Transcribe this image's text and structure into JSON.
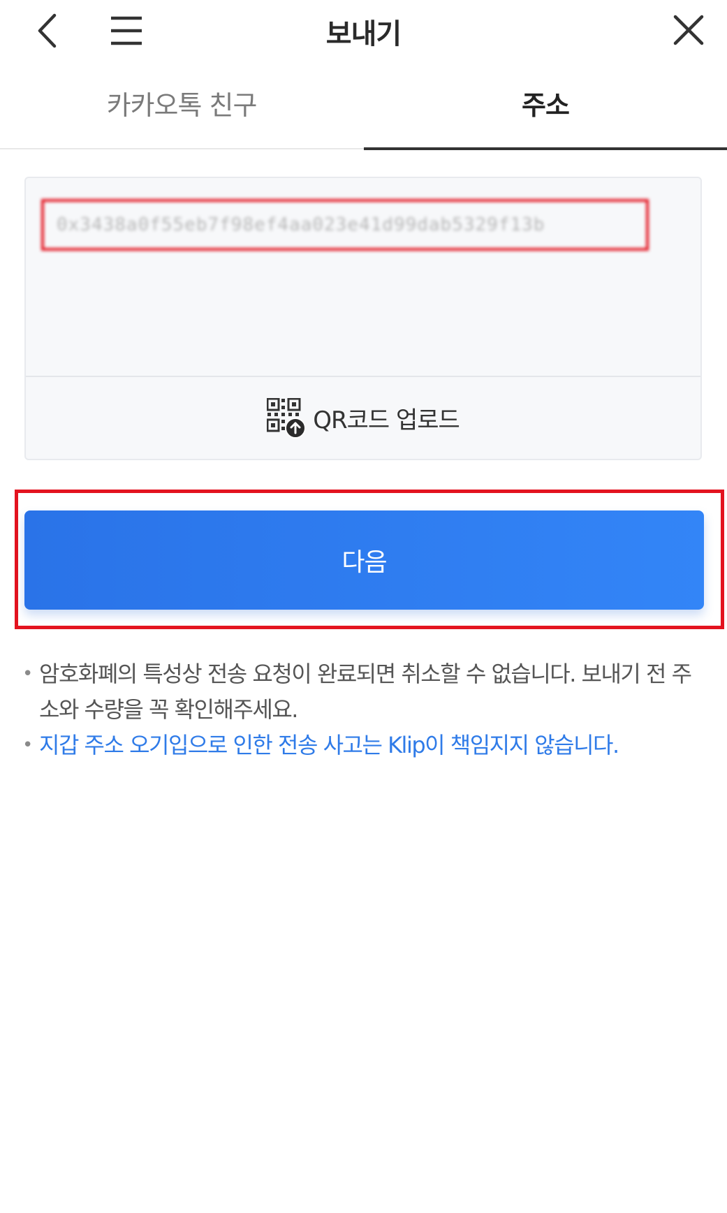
{
  "header": {
    "title": "보내기",
    "back_icon": "chevron-left-icon",
    "menu_icon": "hamburger-menu-icon",
    "close_icon": "close-icon"
  },
  "tabs": [
    {
      "label": "카카오톡 친구",
      "active": false
    },
    {
      "label": "주소",
      "active": true
    }
  ],
  "address": {
    "value": "0x3438a0f55eb7f98ef4aa023e41d99dab5329f13b",
    "qr_upload_label": "QR코드 업로드",
    "qr_icon": "qr-upload-icon"
  },
  "next_button_label": "다음",
  "notes": [
    {
      "text": "암호화폐의 특성상 전송 요청이 완료되면 취소할 수 없습니다. 보내기 전 주소와 수량을 꼭 확인해주세요.",
      "color": "#555555"
    },
    {
      "text": "지갑 주소 오기입으로 인한 전송 사고는 Klip이 책임지지 않습니다.",
      "color": "#2f7be8"
    }
  ],
  "colors": {
    "accent": "#2f7be8",
    "button": "#2a73e8",
    "highlight_box": "#e3131f"
  }
}
